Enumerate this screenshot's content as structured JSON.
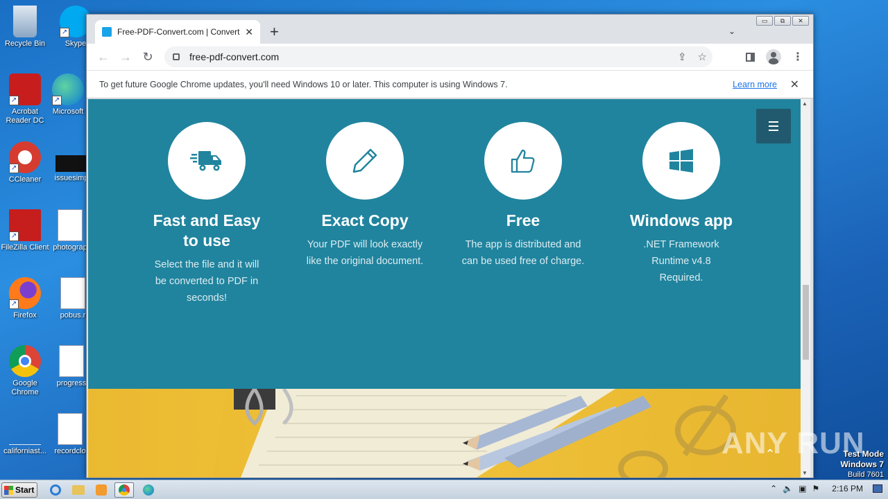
{
  "desktop": {
    "icons": [
      {
        "label": "Recycle Bin",
        "color": "#a9c2dc"
      },
      {
        "label": "Skype",
        "color": "#00a9f0"
      },
      {
        "label": "Acrobat Reader DC",
        "color": "#c81d1d"
      },
      {
        "label": "Microsoft",
        "color": "#0c7ad6"
      },
      {
        "label": "CCleaner",
        "color": "#d63b2f"
      },
      {
        "label": "issuesimp",
        "color": "#111111"
      },
      {
        "label": "FileZilla Client",
        "color": "#c61d1d"
      },
      {
        "label": "photograp",
        "color": "#2b5fb4"
      },
      {
        "label": "Firefox",
        "color": "#ff7a1a"
      },
      {
        "label": "pobus.r",
        "color": "#2b5fb4"
      },
      {
        "label": "Google Chrome",
        "color": "#4285f4"
      },
      {
        "label": "progress",
        "color": "#2b5fb4"
      },
      {
        "label": "californiast...",
        "color": "#1b63b8"
      },
      {
        "label": "recordclo",
        "color": "#2b5fb4"
      }
    ]
  },
  "browser": {
    "tab_title": "Free-PDF-Convert.com | Convert hu",
    "tab_close": "✕",
    "new_tab": "+",
    "url": "free-pdf-convert.com",
    "window_controls": [
      "▭",
      "⧉",
      "✕"
    ],
    "infobar_text": "To get future Google Chrome updates, you'll need Windows 10 or later. This computer is using Windows 7.",
    "infobar_link": "Learn more"
  },
  "page": {
    "features": [
      {
        "icon": "truck-icon",
        "title": "Fast and Easy to use",
        "text": "Select the file and it will be converted to PDF in seconds!"
      },
      {
        "icon": "pencil-icon",
        "title": "Exact Copy",
        "text": "Your PDF will look exactly like the original document."
      },
      {
        "icon": "thumbs-up-icon",
        "title": "Free",
        "text": "The app is distributed and can be used free of charge."
      },
      {
        "icon": "windows-logo-icon",
        "title": "Windows app",
        "text": ".NET Framework Runtime v4.8 Required."
      }
    ],
    "accent_color": "#20849e",
    "menu_button_color": "#215a6e"
  },
  "watermark": "ANY RUN",
  "test_mode": {
    "line1": "Test Mode",
    "line2": "Windows 7",
    "line3": "Build 7601"
  },
  "taskbar": {
    "start_label": "Start",
    "clock": "2:16 PM"
  }
}
